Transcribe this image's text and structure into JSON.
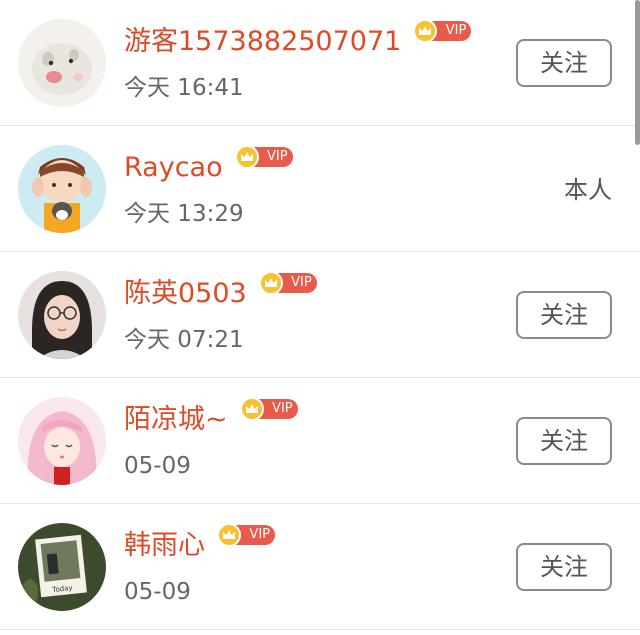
{
  "users": [
    {
      "name": "游客1573882507071",
      "vip_label": "VIP",
      "time": "今天 16:41",
      "action": "关注",
      "is_self": false,
      "avatar_icon": "hamster-avatar"
    },
    {
      "name": "Raycao",
      "vip_label": "VIP",
      "time": "今天 13:29",
      "action": "本人",
      "is_self": true,
      "avatar_icon": "cartoon-boy-avatar"
    },
    {
      "name": "陈英0503",
      "vip_label": "VIP",
      "time": "今天 07:21",
      "action": "关注",
      "is_self": false,
      "avatar_icon": "girl-glasses-avatar"
    },
    {
      "name": "陌凉城~",
      "vip_label": "VIP",
      "time": "05-09",
      "action": "关注",
      "is_self": false,
      "avatar_icon": "anime-girl-avatar"
    },
    {
      "name": "韩雨心",
      "vip_label": "VIP",
      "time": "05-09",
      "action": "关注",
      "is_self": false,
      "avatar_icon": "photo-avatar"
    }
  ],
  "colors": {
    "name": "#dd4b26",
    "vip_pill": "#e85a4a",
    "crown": "#f7c12f",
    "time": "#666666",
    "divider": "#e6e6e6"
  }
}
